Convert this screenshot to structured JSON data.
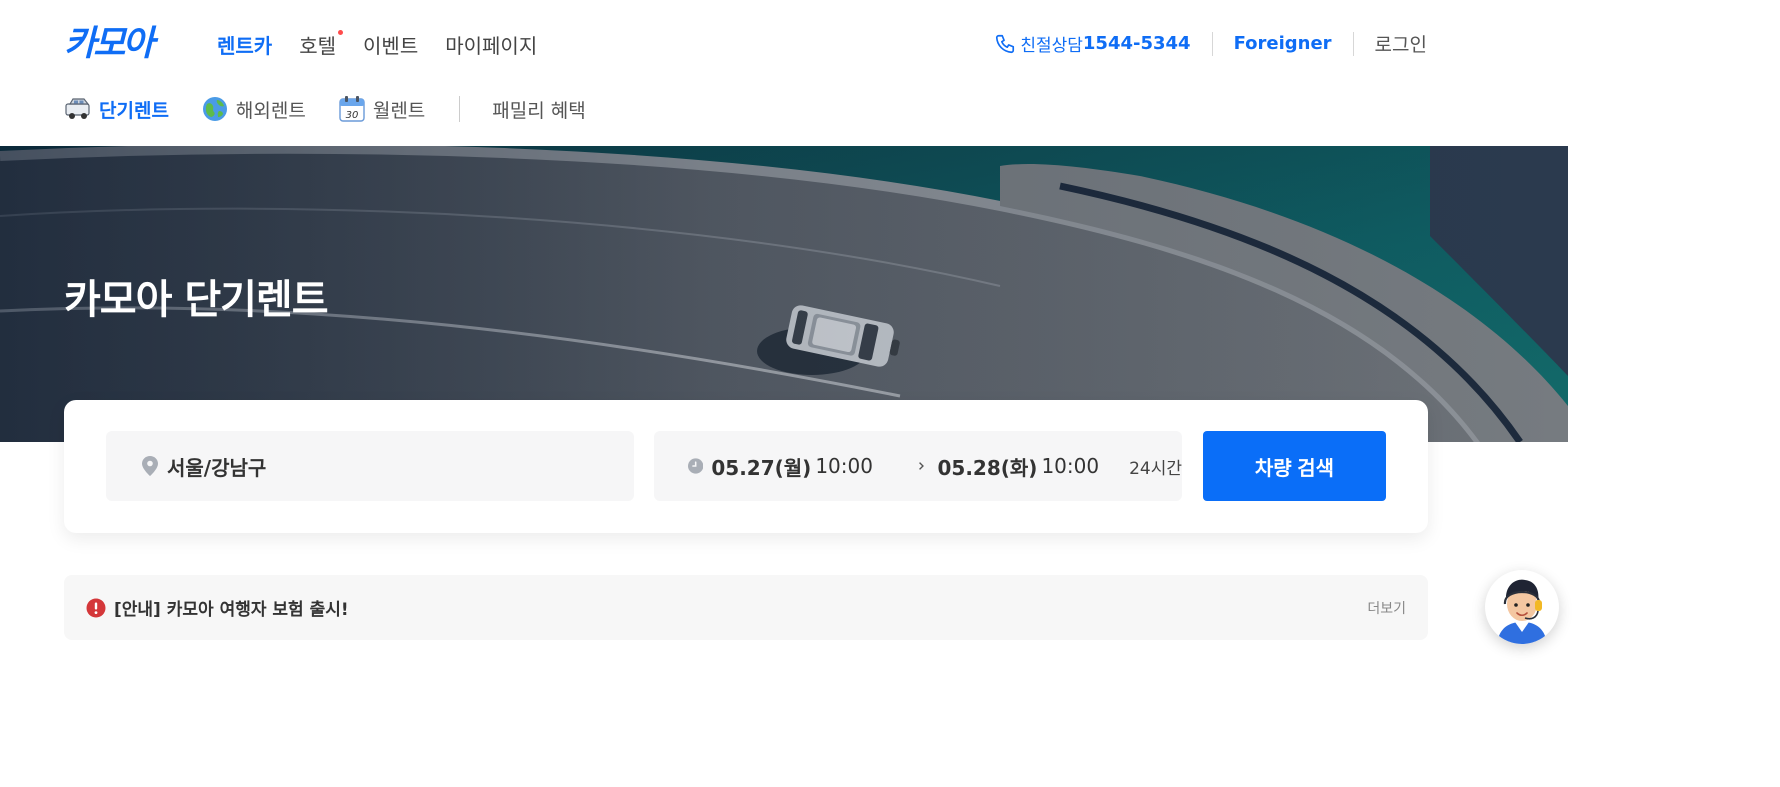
{
  "header": {
    "logo_text": "카모아",
    "nav": [
      {
        "label": "렌트카",
        "active": true
      },
      {
        "label": "호텔",
        "new_dot": true
      },
      {
        "label": "이벤트"
      },
      {
        "label": "마이페이지"
      }
    ],
    "phone_label": "친절상담",
    "phone_number": "1544-5344",
    "foreigner_label": "Foreigner",
    "login_label": "로그인"
  },
  "subnav": [
    {
      "label": "단기렌트",
      "icon": "car-icon",
      "active": true
    },
    {
      "label": "해외렌트",
      "icon": "globe-icon"
    },
    {
      "label": "월렌트",
      "icon": "calendar-icon"
    },
    {
      "label": "패밀리 혜택"
    }
  ],
  "calendar_icon_number": "30",
  "hero": {
    "title": "카모아 단기렌트"
  },
  "search": {
    "location": "서울/강남구",
    "start_date": "05.27(월)",
    "start_time": "10:00",
    "end_date": "05.28(화)",
    "end_time": "10:00",
    "duration": "24시간",
    "button_label": "차량 검색"
  },
  "notice": {
    "text": "[안내] 카모아 여행자 보험 출시!",
    "more_label": "더보기"
  },
  "colors": {
    "brand": "#0f6df5",
    "button": "#0a6ef8",
    "notice_alert": "#d4373a"
  }
}
